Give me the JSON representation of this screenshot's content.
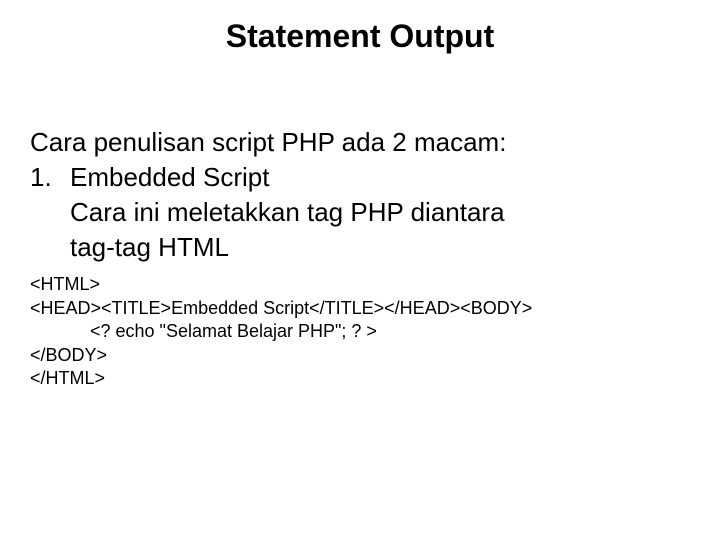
{
  "title": "Statement Output",
  "intro": "Cara penulisan script PHP ada 2 macam:",
  "list": {
    "number": "1.",
    "heading": "Embedded Script",
    "desc1": "Cara ini meletakkan tag PHP diantara",
    "desc2": "tag-tag HTML"
  },
  "code": {
    "l1": "<HTML>",
    "l2": "<HEAD><TITLE>Embedded Script</TITLE></HEAD><BODY>",
    "l3": "<? echo \"Selamat Belajar PHP\"; ? >",
    "l4": "</BODY>",
    "l5": "</HTML>"
  }
}
